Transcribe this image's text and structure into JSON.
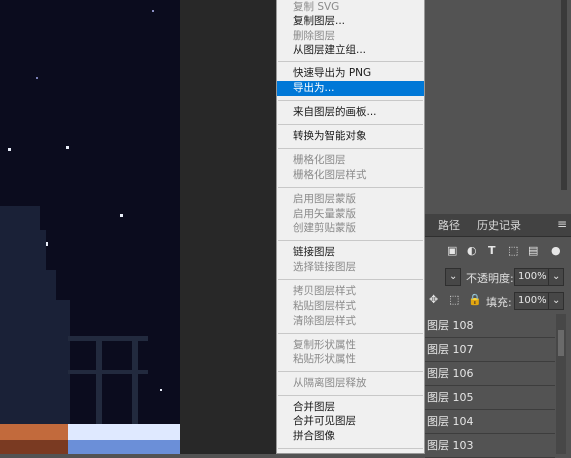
{
  "context_menu": {
    "items": [
      {
        "label": "复制 SVG",
        "enabled": false
      },
      {
        "label": "复制图层...",
        "enabled": true
      },
      {
        "label": "删除图层",
        "enabled": false
      },
      {
        "label": "从图层建立组...",
        "enabled": true
      },
      {
        "label": "快速导出为 PNG",
        "enabled": true
      },
      {
        "label": "导出为...",
        "enabled": true,
        "selected": true
      },
      {
        "label": "来自图层的画板...",
        "enabled": true
      },
      {
        "label": "转换为智能对象",
        "enabled": true
      },
      {
        "label": "栅格化图层",
        "enabled": false
      },
      {
        "label": "栅格化图层样式",
        "enabled": false
      },
      {
        "label": "启用图层蒙版",
        "enabled": false
      },
      {
        "label": "启用矢量蒙版",
        "enabled": false
      },
      {
        "label": "创建剪贴蒙版",
        "enabled": false
      },
      {
        "label": "链接图层",
        "enabled": true
      },
      {
        "label": "选择链接图层",
        "enabled": false
      },
      {
        "label": "拷贝图层样式",
        "enabled": false
      },
      {
        "label": "粘贴图层样式",
        "enabled": false
      },
      {
        "label": "清除图层样式",
        "enabled": false
      },
      {
        "label": "复制形状属性",
        "enabled": false
      },
      {
        "label": "粘贴形状属性",
        "enabled": false
      },
      {
        "label": "从隔离图层释放",
        "enabled": false
      },
      {
        "label": "合并图层",
        "enabled": true
      },
      {
        "label": "合并可见图层",
        "enabled": true
      },
      {
        "label": "拼合图像",
        "enabled": true
      }
    ],
    "selected_color": "#0078d7"
  },
  "panel": {
    "tabs": [
      {
        "label": "路径"
      },
      {
        "label": "历史记录"
      }
    ],
    "menu_icon": "hamburger-icon",
    "filter_icons": [
      "image-filter-icon",
      "adjustment-filter-icon",
      "type-filter-icon",
      "shape-filter-icon",
      "smart-object-filter-icon"
    ],
    "opacity_label": "不透明度:",
    "opacity_value": "100%",
    "fill_label": "填充:",
    "fill_value": "100%",
    "layers": [
      {
        "name": "图层 108"
      },
      {
        "name": "图层 107"
      },
      {
        "name": "图层 106"
      },
      {
        "name": "图层 105"
      },
      {
        "name": "图层 104"
      },
      {
        "name": "图层 103"
      }
    ]
  }
}
